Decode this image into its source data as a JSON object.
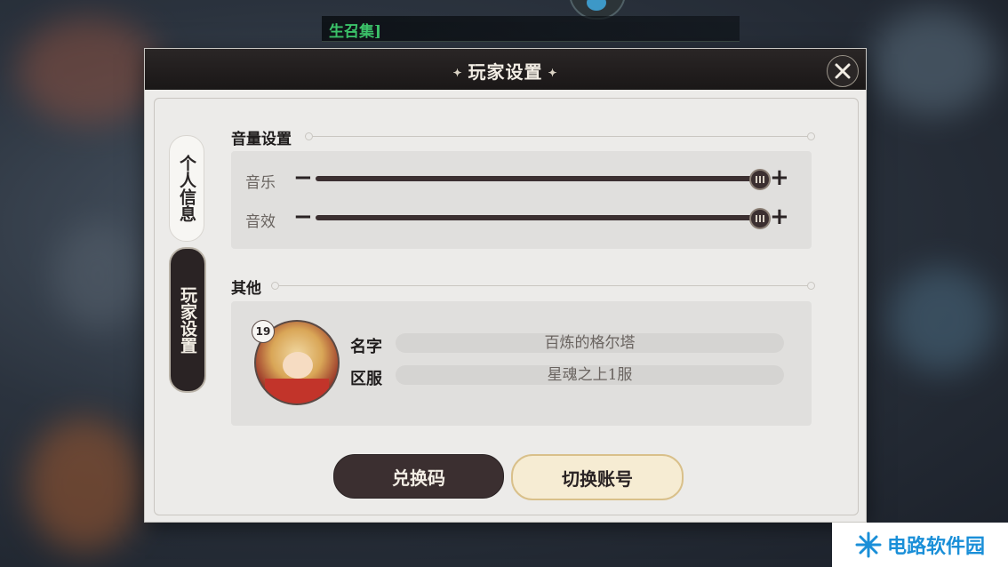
{
  "top_banner": {
    "text": "生召集]"
  },
  "dialog": {
    "title": "玩家设置",
    "close_icon": "close-icon"
  },
  "tabs": [
    {
      "label": "个人信息",
      "active": false
    },
    {
      "label": "玩家设置",
      "active": true
    }
  ],
  "volume": {
    "section_title": "音量设置",
    "sliders": [
      {
        "label": "音乐",
        "level": 1.0
      },
      {
        "label": "音效",
        "level": 1.0
      }
    ],
    "minus_symbol": "−",
    "plus_symbol": "+"
  },
  "other": {
    "section_title": "其他",
    "level": "19",
    "name_label": "名字",
    "name_value": "百炼的格尔塔",
    "server_label": "区服",
    "server_value": "星魂之上1服"
  },
  "buttons": {
    "redeem": "兑换码",
    "switch_account": "切换账号"
  },
  "watermark": {
    "text": "电路软件园"
  },
  "colors": {
    "dark": "#2a2324",
    "panel": "#e0dfdd",
    "accent_gold": "#d9c08a",
    "banner_text": "#3cc46a"
  }
}
